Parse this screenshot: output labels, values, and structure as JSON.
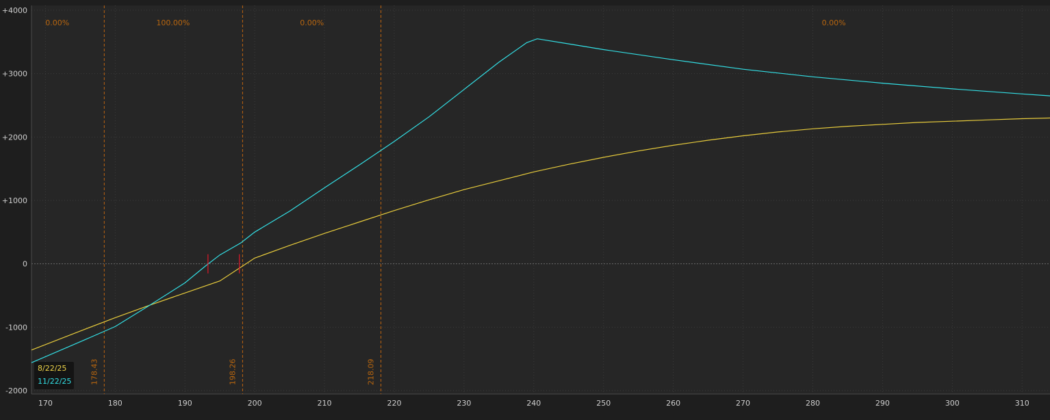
{
  "chart_data": {
    "type": "line",
    "x_axis": {
      "min": 168,
      "max": 314,
      "ticks": [
        170,
        180,
        190,
        200,
        210,
        220,
        230,
        240,
        250,
        260,
        270,
        280,
        290,
        300,
        310
      ]
    },
    "y_axis": {
      "min": -2000,
      "max": 4000,
      "ticks": [
        4000,
        3000,
        2000,
        1000,
        0,
        -1000,
        -2000
      ],
      "tick_labels": [
        "+4000",
        "+3000",
        "+2000",
        "+1000",
        "0",
        "-1000",
        "-2000"
      ]
    },
    "grid": true,
    "legend_position": "bottom-left",
    "series": [
      {
        "name": "8/22/25",
        "color": "#e8cc3c",
        "x": [
          168,
          175,
          180,
          185,
          190,
          195,
          200,
          205,
          210,
          215,
          220,
          225,
          230,
          235,
          240,
          245,
          250,
          255,
          260,
          265,
          270,
          275,
          280,
          285,
          290,
          295,
          300,
          305,
          310,
          314
        ],
        "y": [
          -1360,
          -1060,
          -850,
          -650,
          -460,
          -270,
          90,
          290,
          480,
          660,
          840,
          1010,
          1170,
          1310,
          1450,
          1570,
          1680,
          1780,
          1870,
          1950,
          2020,
          2080,
          2130,
          2170,
          2200,
          2230,
          2250,
          2270,
          2290,
          2300
        ]
      },
      {
        "name": "11/22/25",
        "color": "#33e0e6",
        "x": [
          168,
          175,
          180,
          185,
          190,
          193,
          195,
          198,
          200,
          205,
          210,
          215,
          220,
          225,
          230,
          235,
          239,
          240.5,
          245,
          250,
          260,
          270,
          280,
          290,
          300,
          310,
          314
        ],
        "y": [
          -1560,
          -1230,
          -990,
          -650,
          -300,
          -30,
          140,
          330,
          500,
          830,
          1200,
          1560,
          1930,
          2320,
          2750,
          3180,
          3490,
          3550,
          3470,
          3380,
          3220,
          3070,
          2950,
          2850,
          2760,
          2680,
          2650
        ]
      }
    ],
    "vertical_markers": [
      {
        "x": 178.43,
        "label": "178.43"
      },
      {
        "x": 198.26,
        "label": "198.26"
      },
      {
        "x": 218.09,
        "label": "218.09"
      }
    ],
    "probability_labels": [
      {
        "x_center": 171.7,
        "text": "0.00%"
      },
      {
        "x_center": 188.3,
        "text": "100.00%"
      },
      {
        "x_center": 208.2,
        "text": "0.00%"
      },
      {
        "x_center": 283.0,
        "text": "0.00%"
      }
    ],
    "breakeven_marks": [
      {
        "x": 193.3,
        "y": 0
      },
      {
        "x": 197.8,
        "y": 0
      }
    ]
  },
  "colors": {
    "background": "#1e1e1e",
    "plot_background": "#262626",
    "grid": "#3c3c3c",
    "zero_line": "#6a6a6a",
    "marker": "#c2640f",
    "breakeven": "#e0182a"
  }
}
